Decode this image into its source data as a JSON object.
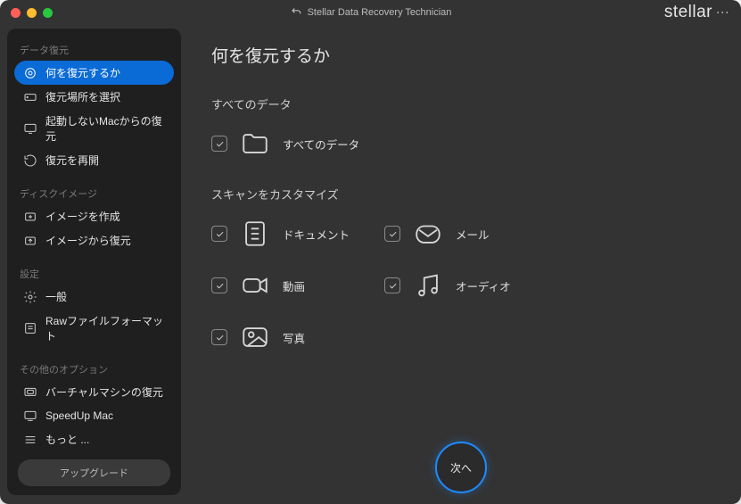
{
  "titlebar": {
    "app_title": "Stellar Data Recovery Technician",
    "brand": "stellar"
  },
  "sidebar": {
    "sections": [
      {
        "title": "データ復元",
        "items": [
          {
            "label": "何を復元するか",
            "icon": "target-icon",
            "active": true
          },
          {
            "label": "復元場所を選択",
            "icon": "drive-icon"
          },
          {
            "label": "起動しないMacからの復元",
            "icon": "mac-icon"
          },
          {
            "label": "復元を再開",
            "icon": "resume-icon"
          }
        ]
      },
      {
        "title": "ディスクイメージ",
        "items": [
          {
            "label": "イメージを作成",
            "icon": "create-image-icon"
          },
          {
            "label": "イメージから復元",
            "icon": "restore-image-icon"
          }
        ]
      },
      {
        "title": "設定",
        "items": [
          {
            "label": "一般",
            "icon": "gear-icon"
          },
          {
            "label": "Rawファイルフォーマット",
            "icon": "raw-icon"
          }
        ]
      },
      {
        "title": "その他のオプション",
        "items": [
          {
            "label": "バーチャルマシンの復元",
            "icon": "vm-icon"
          },
          {
            "label": "SpeedUp Mac",
            "icon": "speedup-icon"
          },
          {
            "label": "もっと ...",
            "icon": "more-icon"
          }
        ]
      }
    ],
    "upgrade": "アップグレード"
  },
  "main": {
    "heading": "何を復元するか",
    "section_all_title": "すべてのデータ",
    "all": {
      "label": "すべてのデータ",
      "checked": true
    },
    "section_custom_title": "スキャンをカスタマイズ",
    "options": [
      {
        "label": "ドキュメント",
        "icon": "document-icon",
        "checked": true
      },
      {
        "label": "メール",
        "icon": "mail-icon",
        "checked": true
      },
      {
        "label": "動画",
        "icon": "video-icon",
        "checked": true
      },
      {
        "label": "オーディオ",
        "icon": "audio-icon",
        "checked": true
      },
      {
        "label": "写真",
        "icon": "photo-icon",
        "checked": true
      }
    ],
    "next_label": "次へ"
  }
}
